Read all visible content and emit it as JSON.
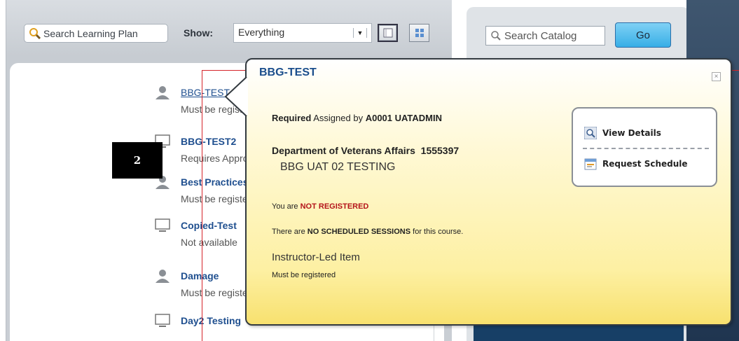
{
  "toolbar": {
    "search_plan_placeholder": "Search Learning Plan",
    "show_label": "Show:",
    "show_value": "Everything",
    "search_catalog_placeholder": "Search Catalog",
    "go_label": "Go"
  },
  "list": {
    "items": [
      {
        "title": "BBG-TEST",
        "subtitle": "Must be registered",
        "icon": "person-icon"
      },
      {
        "title": "BBG-TEST2",
        "subtitle": "Requires Approval",
        "icon": "monitor-icon"
      },
      {
        "title": "Best Practices",
        "subtitle": "Must be registered",
        "icon": "person-icon"
      },
      {
        "title": "Copied-Test",
        "subtitle": "Not available",
        "icon": "monitor-icon"
      },
      {
        "title": "Damage",
        "subtitle": "Must be registered",
        "icon": "person-icon"
      },
      {
        "title": "Day2 Testing",
        "subtitle": "",
        "icon": "monitor-icon"
      }
    ]
  },
  "annotation": {
    "step": "2"
  },
  "popup": {
    "title": "BBG-TEST",
    "required_label": "Required",
    "assigned_by_label": "Assigned by",
    "assigned_by_value": "A0001 UATADMIN",
    "department": "Department of Veterans Affairs",
    "department_code": "1555397",
    "course_name": "BBG UAT 02 TESTING",
    "registration_prefix": "You are",
    "registration_status": "NOT REGISTERED",
    "sessions_prefix": "There are",
    "sessions_status": "NO SCHEDULED SESSIONS",
    "sessions_suffix": "for this course.",
    "item_type": "Instructor-Led Item",
    "item_requirement": "Must be registered",
    "actions": {
      "view_details": "View Details",
      "request_schedule": "Request Schedule"
    },
    "close_glyph": "×"
  },
  "colors": {
    "link": "#1f4f8f",
    "status_red": "#b4141a",
    "go_button": "#37aee6",
    "popup_yellow": "#f7e06c"
  }
}
